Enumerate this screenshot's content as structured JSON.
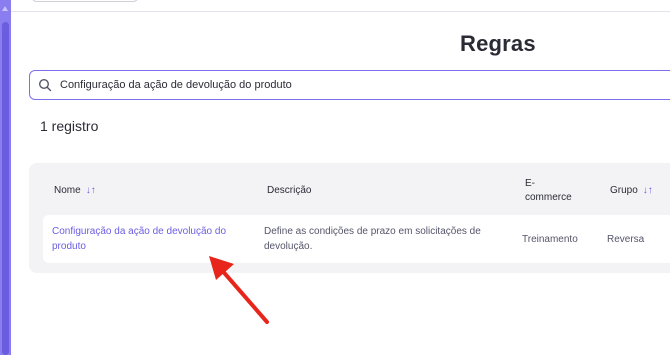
{
  "page": {
    "title": "Regras"
  },
  "search": {
    "value": "Configuração da ação de devolução do produto"
  },
  "results": {
    "count_label": "1 registro"
  },
  "table": {
    "headers": {
      "name": "Nome",
      "description": "Descrição",
      "ecommerce": "E-\ncommerce",
      "group": "Grupo"
    },
    "rows": [
      {
        "name": "Configuração da ação de devolução do produto",
        "description": "Define as condições de prazo em solicitações de devolução.",
        "ecommerce": "Treinamento",
        "group": "Reversa"
      }
    ]
  },
  "colors": {
    "accent": "#6a5de0",
    "annotation_arrow": "#e8251b"
  },
  "icons": {
    "search": "search-icon",
    "sort": "sort-arrows-icon",
    "annotation": "red-arrow-icon"
  }
}
